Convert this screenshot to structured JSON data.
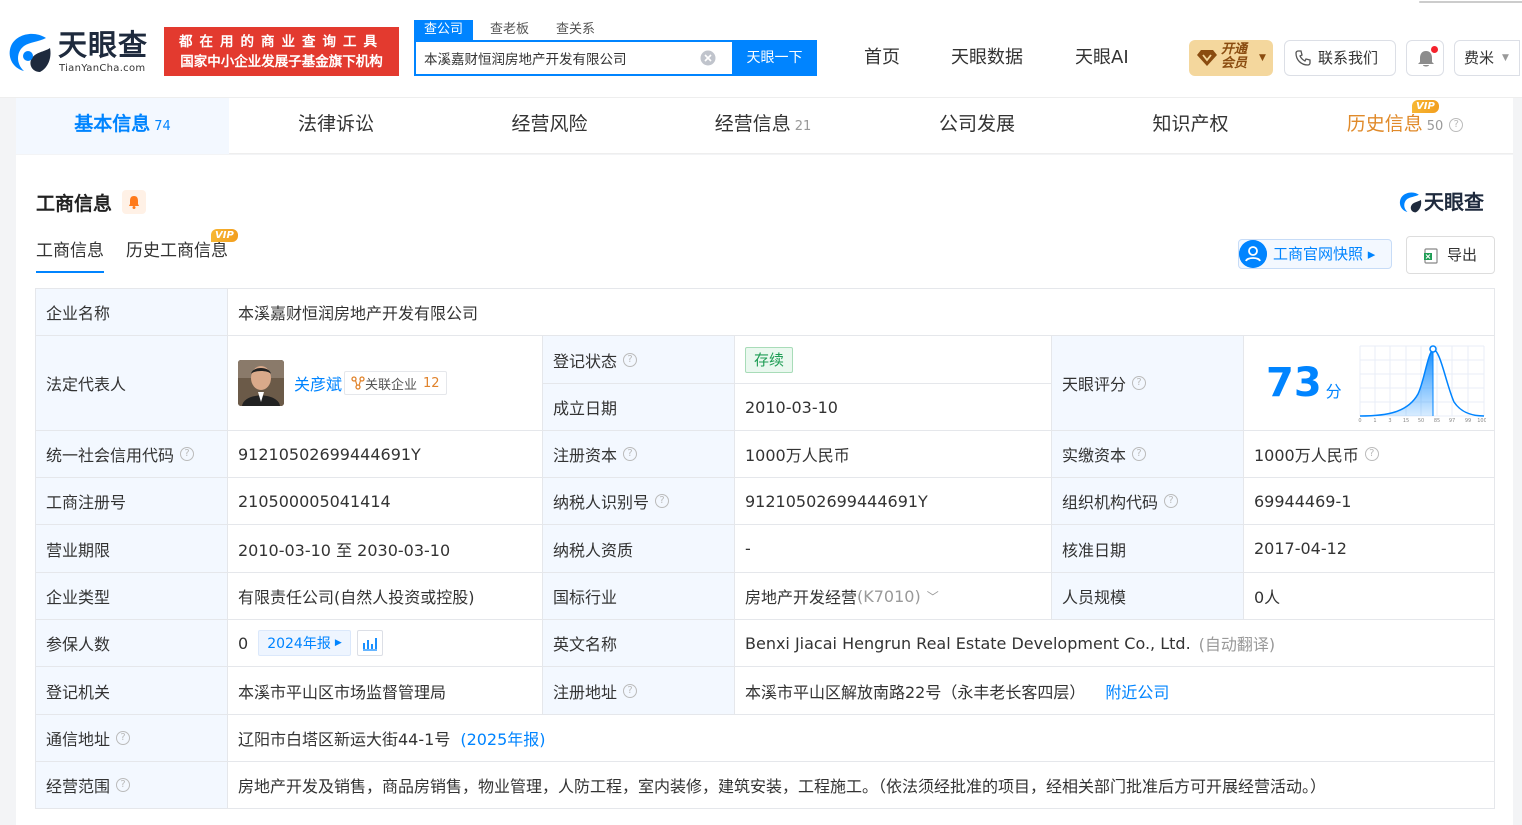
{
  "header": {
    "logo_text": "天眼查",
    "logo_sub": "TianYanCha.com",
    "banner_line1": "都在用的商业查询工具",
    "banner_line2": "国家中小企业发展子基金旗下机构",
    "search_tabs": [
      "查公司",
      "查老板",
      "查关系"
    ],
    "search_value": "本溪嘉财恒润房地产开发有限公司",
    "search_button": "天眼一下",
    "nav": [
      "首页",
      "天眼数据",
      "天眼AI"
    ],
    "vip_label": "开通会员",
    "contact_label": "联系我们",
    "user_name": "费米"
  },
  "main_tabs": [
    {
      "label": "基本信息",
      "count": "74"
    },
    {
      "label": "法律诉讼",
      "count": ""
    },
    {
      "label": "经营风险",
      "count": ""
    },
    {
      "label": "经营信息",
      "count": "21"
    },
    {
      "label": "公司发展",
      "count": ""
    },
    {
      "label": "知识产权",
      "count": ""
    },
    {
      "label": "历史信息",
      "count": "50",
      "vip": "VIP"
    }
  ],
  "section": {
    "title": "工商信息",
    "logo_text": "天眼查",
    "sub_tabs": [
      "工商信息",
      "历史工商信息"
    ],
    "sub_tab_vip": "VIP",
    "snapshot_button": "工商官网快照",
    "export_button": "导出"
  },
  "company": {
    "name_label": "企业名称",
    "name": "本溪嘉财恒润房地产开发有限公司",
    "legal_rep_label": "法定代表人",
    "legal_rep": "关彦斌",
    "related_label": "关联企业",
    "related_count": "12",
    "reg_status_label": "登记状态",
    "reg_status": "存续",
    "found_date_label": "成立日期",
    "found_date": "2010-03-10",
    "score_label": "天眼评分",
    "score": "73",
    "score_unit": "分",
    "score_axis": [
      "0",
      "1",
      "3",
      "15",
      "50",
      "85",
      "97",
      "99",
      "100"
    ],
    "credit_code_label": "统一社会信用代码",
    "credit_code": "91210502699444691Y",
    "reg_capital_label": "注册资本",
    "reg_capital": "1000万人民币",
    "paid_capital_label": "实缴资本",
    "paid_capital": "1000万人民币",
    "biz_reg_no_label": "工商注册号",
    "biz_reg_no": "210500005041414",
    "taxpayer_id_label": "纳税人识别号",
    "taxpayer_id": "91210502699444691Y",
    "org_code_label": "组织机构代码",
    "org_code": "69944469-1",
    "biz_term_label": "营业期限",
    "biz_term": "2010-03-10 至 2030-03-10",
    "taxpayer_qual_label": "纳税人资质",
    "taxpayer_qual": "-",
    "approve_date_label": "核准日期",
    "approve_date": "2017-04-12",
    "type_label": "企业类型",
    "type": "有限责任公司(自然人投资或控股)",
    "industry_label": "国标行业",
    "industry": "房地产开发经营",
    "industry_code": "(K7010)",
    "staff_size_label": "人员规模",
    "staff_size": "0人",
    "insured_label": "参保人数",
    "insured": "0",
    "insured_year": "2024年报",
    "en_name_label": "英文名称",
    "en_name": "Benxi Jiacai Hengrun Real Estate Development Co., Ltd.",
    "en_name_note": "(自动翻译)",
    "authority_label": "登记机关",
    "authority": "本溪市平山区市场监督管理局",
    "reg_addr_label": "注册地址",
    "reg_addr": "本溪市平山区解放南路22号（永丰老长客四层）",
    "nearby_link": "附近公司",
    "mail_addr_label": "通信地址",
    "mail_addr": "辽阳市白塔区新运大街44-1号",
    "mail_addr_year": "(2025年报)",
    "scope_label": "经营范围",
    "scope": "房地产开发及销售，商品房销售，物业管理，人防工程，室内装修，建筑安装，工程施工。（依法须经批准的项目，经相关部门批准后方可开展经营活动。）"
  },
  "colors": {
    "primary": "#0084ff",
    "label_bg": "#f3f8ff",
    "vip": "#f29e1f",
    "banner": "#e33a2f"
  }
}
